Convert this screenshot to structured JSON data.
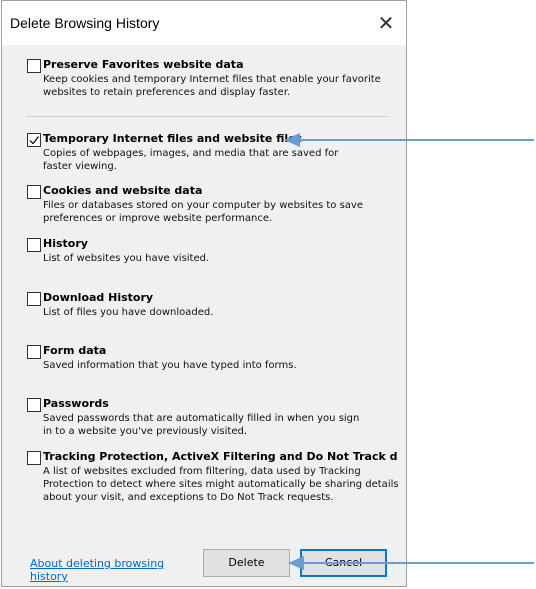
{
  "window": {
    "title": "Delete Browsing History",
    "close_glyph": "✕"
  },
  "options": [
    {
      "label": "Preserve Favorites website data",
      "description": "Keep cookies and temporary Internet files that enable your favorite\nwebsites to retain preferences and display faster.",
      "checked": false
    },
    {
      "label": "Temporary Internet files and website files",
      "description": "Copies of webpages, images, and media that are saved for\nfaster viewing.",
      "checked": true
    },
    {
      "label": "Cookies and website data",
      "description": "Files or databases stored on your computer by websites to save\npreferences or improve website performance.",
      "checked": false
    },
    {
      "label": "History",
      "description": "List of websites you have visited.",
      "checked": false
    },
    {
      "label": "Download History",
      "description": "List of files you have downloaded.",
      "checked": false
    },
    {
      "label": "Form data",
      "description": "Saved information that you have typed into forms.",
      "checked": false
    },
    {
      "label": "Passwords",
      "description": "Saved passwords that are automatically filled in when you sign\nin to a website you've previously visited.",
      "checked": false
    },
    {
      "label": "Tracking Protection, ActiveX Filtering and Do Not Track d",
      "description": "A list of websites excluded from filtering, data used by Tracking\nProtection to detect where sites might automatically be sharing details\nabout your visit, and exceptions to Do Not Track requests.",
      "checked": false
    }
  ],
  "footer": {
    "link_text": "About deleting browsing\nhistory",
    "delete_label": "Delete",
    "cancel_label": "Cancel"
  },
  "colors": {
    "arrow": "#6a9bd1",
    "link": "#0066cc",
    "focus": "#0078d7"
  }
}
